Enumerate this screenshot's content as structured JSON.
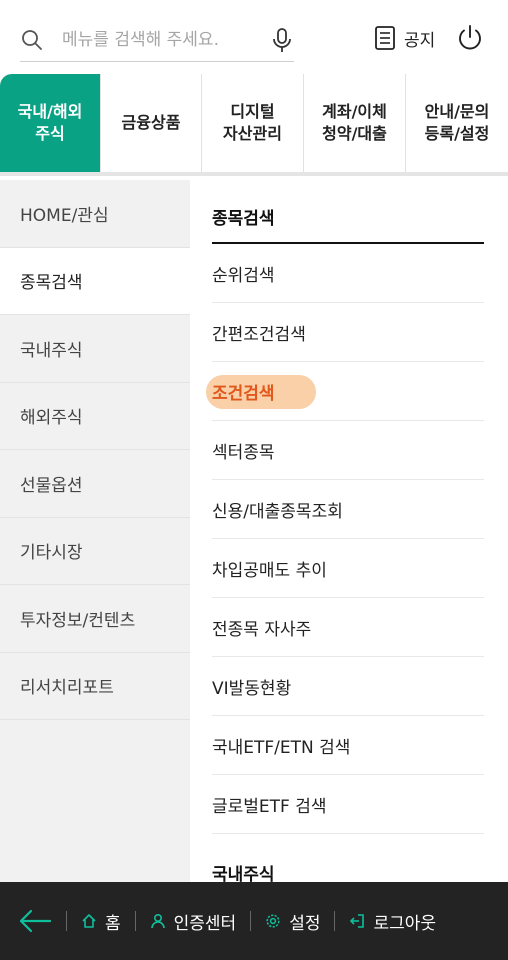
{
  "search": {
    "placeholder": "메뉴를 검색해 주세요."
  },
  "header": {
    "notice_label": "공지"
  },
  "tabs": [
    {
      "label": "국내/해외\n주식",
      "active": true
    },
    {
      "label": "금융상품",
      "active": false
    },
    {
      "label": "디지털\n자산관리",
      "active": false
    },
    {
      "label": "계좌/이체\n청약/대출",
      "active": false
    },
    {
      "label": "안내/문의\n등록/설정",
      "active": false
    }
  ],
  "sidebar": {
    "items": [
      {
        "label": "HOME/관심"
      },
      {
        "label": "종목검색"
      },
      {
        "label": "국내주식"
      },
      {
        "label": "해외주식"
      },
      {
        "label": "선물옵션"
      },
      {
        "label": "기타시장"
      },
      {
        "label": "투자정보/컨텐츠"
      },
      {
        "label": "리서치리포트"
      }
    ]
  },
  "content": {
    "section_title": "종목검색",
    "items": [
      {
        "label": "순위검색"
      },
      {
        "label": "간편조건검색"
      },
      {
        "label": "조건검색"
      },
      {
        "label": "섹터종목"
      },
      {
        "label": "신용/대출종목조회"
      },
      {
        "label": "차입공매도 추이"
      },
      {
        "label": "전종목 자사주"
      },
      {
        "label": "VI발동현황"
      },
      {
        "label": "국내ETF/ETN 검색"
      },
      {
        "label": "글로벌ETF 검색"
      }
    ],
    "next_section_title": "국내주식"
  },
  "bottom_nav": {
    "home_label": "홈",
    "auth_label": "인증센터",
    "settings_label": "설정",
    "logout_label": "로그아웃"
  },
  "colors": {
    "accent": "#0aa284",
    "highlight": "#e0581c",
    "bottom_bar": "#232323"
  },
  "icons": [
    "search-icon",
    "mic-icon",
    "notice-icon",
    "power-icon",
    "back-arrow-icon",
    "home-icon",
    "person-icon",
    "gear-icon",
    "logout-icon"
  ]
}
